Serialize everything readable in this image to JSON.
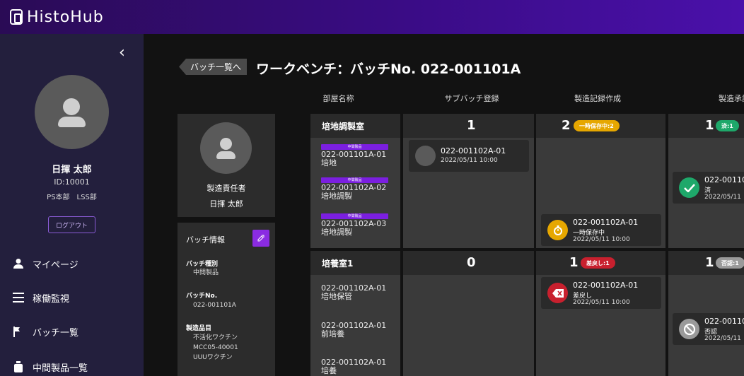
{
  "app": {
    "logo_text": "HistoHub"
  },
  "sidebar": {
    "collapse_glyph": "‹",
    "user": {
      "name": "日揮 太郎",
      "id": "ID:10001",
      "dept": "PS本部　LSS部"
    },
    "logout_label": "ログアウト",
    "nav": [
      {
        "label": "マイページ",
        "icon": "person-icon"
      },
      {
        "label": "稼働監視",
        "icon": "menu-icon"
      },
      {
        "label": "バッチ一覧",
        "icon": "flag-icon"
      },
      {
        "label": "中間製品一覧",
        "icon": "flask-icon"
      }
    ]
  },
  "header": {
    "back_label": "バッチ一覧へ",
    "title": "ワークベンチ：バッチNo. 022-001101A"
  },
  "responsible": {
    "label": "製造責任者",
    "name": "日揮 太郎"
  },
  "batch_info": {
    "title": "バッチ情報",
    "edit_icon": "edit-icon",
    "type_label": "バッチ種別",
    "type_value": "中間製品",
    "no_label": "バッチNo.",
    "no_value": "022-001101A",
    "product_label": "製造品目",
    "product_values": [
      "不活化ワクチン",
      "MCC05-40001",
      "UUUワクチン"
    ]
  },
  "columns": [
    "部屋名称",
    "サブバッチ登録",
    "製造記録作成",
    "製造承認"
  ],
  "rooms": [
    {
      "name": "培地調製室",
      "sub_items": [
        {
          "tag": "中間製品",
          "code": "022-001101A-01",
          "desc": "培地"
        },
        {
          "tag": "中間製品",
          "code": "022-001102A-02",
          "desc": "培地調製"
        },
        {
          "tag": "中間製品",
          "code": "022-001102A-03",
          "desc": "培地調製"
        }
      ],
      "sub_count": "1",
      "rec_count": "2",
      "rec_badge": "一時保存中:2",
      "app_count": "1",
      "app_badge": "済:1",
      "sub_entries": [
        {
          "code": "022-001102A-01",
          "status": "",
          "date": "2022/05/11 10:00"
        }
      ],
      "rec_entries": [
        {
          "code": "022-001102A-01",
          "status": "一時保存中",
          "date": "2022/05/11 10:00"
        }
      ],
      "app_entries": [
        {
          "code": "022-00110",
          "status": "済",
          "date": "2022/05/11"
        }
      ]
    },
    {
      "name": "培養室1",
      "sub_items": [
        {
          "code": "022-001102A-01",
          "desc": "培地保管"
        },
        {
          "code": "022-001102A-01",
          "desc": "前培養"
        },
        {
          "code": "022-001102A-01",
          "desc": "培養"
        }
      ],
      "sub_count": "0",
      "rec_count": "1",
      "rec_badge": "差戻し:1",
      "app_count": "1",
      "app_badge": "否認:1",
      "rec_entries": [
        {
          "code": "022-001102A-01",
          "status": "差戻し",
          "date": "2022/05/11 10:00"
        }
      ],
      "app_entries": [
        {
          "code": "022-00110",
          "status": "否認",
          "date": "2022/05/11"
        }
      ]
    }
  ],
  "colors": {
    "accent": "#8a2be2",
    "saving": "#e6a700",
    "done": "#1ea86a",
    "returned": "#c8202e",
    "denied": "#9a9a9a"
  }
}
